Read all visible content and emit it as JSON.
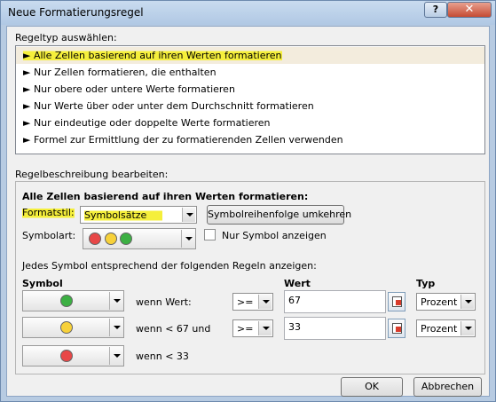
{
  "window": {
    "title": "Neue Formatierungsregel",
    "help_label": "?",
    "close_label": "✕"
  },
  "rule_type": {
    "label": "Regeltyp auswählen:",
    "items": [
      "► Alle Zellen basierend auf ihren Werten formatieren",
      "► Nur Zellen formatieren, die enthalten",
      "► Nur obere oder untere Werte formatieren",
      "► Nur Werte über oder unter dem Durchschnitt formatieren",
      "► Nur eindeutige oder doppelte Werte formatieren",
      "► Formel zur Ermittlung der zu formatierenden Zellen verwenden"
    ]
  },
  "description": {
    "label": "Regelbeschreibung bearbeiten:",
    "heading": "Alle Zellen basierend auf ihren Werten formatieren:",
    "format_style_label": "Formatstil:",
    "format_style_value": "Symbolsätze",
    "reverse_order_button": "Symbolreihenfolge umkehren",
    "icon_style_label": "Symbolart:",
    "icon_only_label": "Nur Symbol anzeigen",
    "rules_caption": "Jedes Symbol entsprechend der folgenden Regeln anzeigen:",
    "col_symbol": "Symbol",
    "col_value": "Wert",
    "col_type": "Typ",
    "rows": [
      {
        "color": "#3cb043",
        "text": "wenn Wert:",
        "op": ">=",
        "value": "67",
        "type": "Prozent"
      },
      {
        "color": "#f7d13a",
        "text": "wenn < 67 und",
        "op": ">=",
        "value": "33",
        "type": "Prozent"
      },
      {
        "color": "#e84848",
        "text": "wenn < 33"
      }
    ]
  },
  "footer": {
    "ok_label": "OK",
    "cancel_label": "Abbrechen"
  },
  "colors": {
    "red": "#e84848",
    "yellow": "#f7d13a",
    "green": "#3cb043",
    "highlight": "#f5ef3b"
  }
}
